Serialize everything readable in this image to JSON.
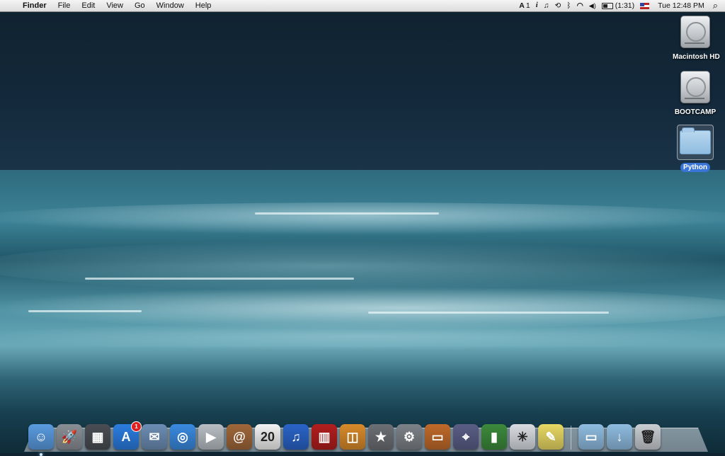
{
  "menubar": {
    "apple_glyph": "",
    "app_name": "Finder",
    "menus": [
      "File",
      "Edit",
      "View",
      "Go",
      "Window",
      "Help"
    ],
    "status": {
      "adobe_count": "1",
      "info_glyph": "i",
      "music_glyph": "♫",
      "time_machine_glyph": "⟲",
      "bluetooth_glyph": "ᛒ",
      "wifi_glyph": "◠",
      "volume_glyph": "◀)",
      "battery_time": "(1:31)",
      "clock": "Tue 12:48 PM",
      "spotlight_glyph": "⌕"
    }
  },
  "desktop": {
    "icons": [
      {
        "label": "Macintosh HD"
      },
      {
        "label": "BOOTCAMP"
      },
      {
        "label": "Python"
      }
    ]
  },
  "dock": {
    "apps": [
      {
        "icon": "finder-icon",
        "glyph": "☺",
        "color": "#5a9be0"
      },
      {
        "icon": "launchpad-icon",
        "glyph": "🚀",
        "color": "#8a8f96"
      },
      {
        "icon": "dashboard-icon",
        "glyph": "▦",
        "color": "#4a4e54"
      },
      {
        "icon": "app-store-icon",
        "glyph": "A",
        "color": "#2b7de0",
        "badge": "1"
      },
      {
        "icon": "mail-icon",
        "glyph": "✉",
        "color": "#6c8db4"
      },
      {
        "icon": "safari-icon",
        "glyph": "◎",
        "color": "#3a8ae0"
      },
      {
        "icon": "facetime-icon",
        "glyph": "▶",
        "color": "#b8bec4"
      },
      {
        "icon": "address-book-icon",
        "glyph": "@",
        "color": "#a0673a"
      },
      {
        "icon": "calendar-icon",
        "glyph": "20",
        "color": "#f2f2f2"
      },
      {
        "icon": "itunes-icon",
        "glyph": "♫",
        "color": "#2a64c8"
      },
      {
        "icon": "photo-booth-icon",
        "glyph": "▥",
        "color": "#b21e1e"
      },
      {
        "icon": "iphoto-icon",
        "glyph": "◫",
        "color": "#d88a2a"
      },
      {
        "icon": "imovie-icon",
        "glyph": "★",
        "color": "#6c6f74"
      },
      {
        "icon": "system-preferences-icon",
        "glyph": "⚙",
        "color": "#7d8288"
      },
      {
        "icon": "keynote-icon",
        "glyph": "▭",
        "color": "#c06a2a"
      },
      {
        "icon": "network-utility-icon",
        "glyph": "⌖",
        "color": "#5a5e86"
      },
      {
        "icon": "numbers-icon",
        "glyph": "▮",
        "color": "#3c8a3c"
      },
      {
        "icon": "python-launcher-icon",
        "glyph": "✳",
        "color": "#d9dde2"
      },
      {
        "icon": "stickies-icon",
        "glyph": "✎",
        "color": "#e8d864"
      }
    ],
    "stacks": [
      {
        "icon": "documents-stack-icon",
        "glyph": "▭",
        "color": "#8fbce0"
      },
      {
        "icon": "downloads-stack-icon",
        "glyph": "↓",
        "color": "#8fbce0"
      },
      {
        "icon": "trash-icon",
        "glyph": "🗑",
        "color": "#c9ced3"
      }
    ]
  }
}
